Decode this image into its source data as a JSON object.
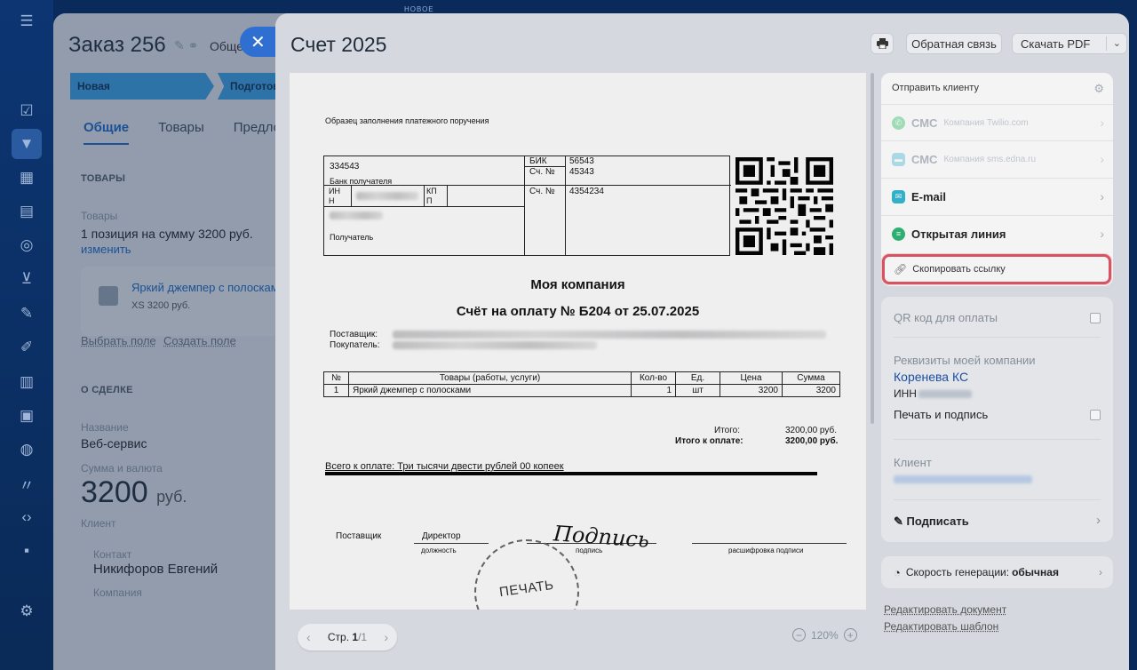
{
  "order": {
    "title": "Заказ 256",
    "subtitle": "Общее",
    "stages": [
      "Новая",
      "Подготовка"
    ],
    "tabs": [
      "Общие",
      "Товары",
      "Предлож"
    ],
    "goods_section": "ТОВАРЫ",
    "goods_label": "Товары",
    "goods_summary": "1 позиция на сумму 3200 руб.",
    "change_link": "изменить",
    "product_name": "Яркий джемпер с полосками",
    "product_desc": "XS  3200 руб.",
    "choose_field": "Выбрать поле",
    "create_field": "Создать поле",
    "deal_section": "О СДЕЛКЕ",
    "name_label": "Название",
    "name_value": "Веб-сервис",
    "sum_label": "Сумма и валюта",
    "sum_value": "3200",
    "sum_currency": "руб.",
    "client_label": "Клиент",
    "contact_label": "Контакт",
    "contact_value": "Никифоров Евгений",
    "company_label": "Компания"
  },
  "badge_new": "НОВОЕ",
  "dialog": {
    "title": "Счет 2025",
    "feedback_btn": "Обратная связь",
    "pdf_btn": "Скачать PDF"
  },
  "document": {
    "sample_title": "Образец заполнения платежного поручения",
    "bank_account": "334543",
    "bank_recipient": "Банк получателя",
    "inn": "ИН\nН",
    "kpp": "КП\nП",
    "recipient": "Получатель",
    "bik_label": "БИК",
    "bik_value": "56543",
    "acct_label": "Сч. №",
    "acct_value": "45343",
    "acct2_label": "Сч. №",
    "acct2_value": "4354234",
    "company": "Моя компания",
    "invoice_title": "Счёт на оплату № Б204 от 25.07.2025",
    "supplier_label": "Поставщик:",
    "buyer_label": "Покупатель:",
    "table_headers": [
      "№",
      "Товары (работы, услуги)",
      "Кол-во",
      "Ед.",
      "Цена",
      "Сумма"
    ],
    "table_rows": [
      [
        "1",
        "Яркий джемпер с полосками",
        "1",
        "шт",
        "3200",
        "3200"
      ]
    ],
    "total_label": "Итого:",
    "total_value": "3200,00 руб.",
    "to_pay_label": "Итого к оплате:",
    "to_pay_value": "3200,00 руб.",
    "total_words": "Всего к оплате: Три тысячи двести рублей 00 копеек",
    "sign_supplier": "Поставщик",
    "sign_position": "Директор",
    "sign_position_caption": "должность",
    "sign_caption": "подпись",
    "sign_decode_caption": "расшифровка подписи",
    "signature": "Подпись",
    "stamp": "ПЕЧАТЬ"
  },
  "pager": {
    "label": "Стр. ",
    "current": "1",
    "total": "/1"
  },
  "zoom": {
    "value": "120%",
    "minus": "−",
    "plus": "+"
  },
  "send": {
    "heading": "Отправить клиенту",
    "rows": [
      {
        "name": "СМС",
        "provider": "Компания Twilio.com",
        "icon_color": "#39c76b"
      },
      {
        "name": "СМС",
        "provider": "Компания sms.edna.ru",
        "icon_color": "#4fc3d8"
      },
      {
        "name": "E-mail",
        "provider": "",
        "icon_color": "#2fb8cf"
      },
      {
        "name": "Открытая линия",
        "provider": "",
        "icon_color": "#2bb673"
      }
    ],
    "copy_link": "Скопировать ссылку"
  },
  "options": {
    "qr_label": "QR код для оплаты",
    "company_details_label": "Реквизиты моей компании",
    "company_name": "Коренева КС",
    "inn_label": "ИНН",
    "print_sign_label": "Печать и подпись",
    "client_label": "Клиент",
    "sign_label": "Подписать"
  },
  "speed": {
    "label": "Скорость генерации:",
    "value": "обычная"
  },
  "edit_doc": "Редактировать документ",
  "edit_tpl": "Редактировать шаблон",
  "colors": {
    "accent": "#2f6fd1",
    "highlight": "#e05663",
    "stage": "#3aa3e6"
  }
}
